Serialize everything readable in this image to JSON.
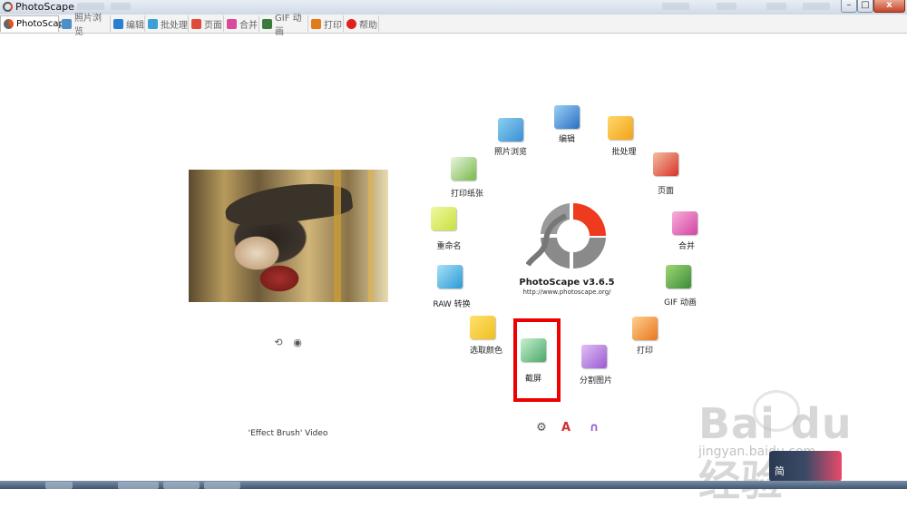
{
  "window": {
    "title": "PhotoScape",
    "buttons": {
      "minimize": "–",
      "maximize": "□",
      "close": "x"
    }
  },
  "tabs": [
    {
      "label": "PhotoScape",
      "icon": "photoscape-icon",
      "color": "#e8521e",
      "active": true
    },
    {
      "label": "照片浏览",
      "icon": "viewer-icon",
      "color": "#4a90c9",
      "active": false
    },
    {
      "label": "编辑",
      "icon": "editor-icon",
      "color": "#2a7fd4",
      "active": false
    },
    {
      "label": "批处理",
      "icon": "batch-icon",
      "color": "#3aa0d8",
      "active": false
    },
    {
      "label": "页面",
      "icon": "page-icon",
      "color": "#e04a3a",
      "active": false
    },
    {
      "label": "合并",
      "icon": "combine-icon",
      "color": "#d84a9a",
      "active": false
    },
    {
      "label": "GIF 动画",
      "icon": "gif-icon",
      "color": "#3a7a3a",
      "active": false
    },
    {
      "label": "打印",
      "icon": "print-icon",
      "color": "#e07a1a",
      "active": false
    },
    {
      "label": "帮助",
      "icon": "help-icon",
      "color": "#e02020",
      "active": false
    }
  ],
  "photo": {
    "caption": "'Effect Brush' Video",
    "prev": "⟲",
    "next": "◉"
  },
  "logo": {
    "name": "PhotoScape v3.6.5",
    "url": "http://www.photoscape.org/",
    "accent": "#ee3b1d",
    "gray": "#8a8a8a"
  },
  "tools": [
    {
      "label": "照片浏览",
      "icon": "viewer-icon",
      "color": "#3b8ed6"
    },
    {
      "label": "编辑",
      "icon": "editor-icon",
      "color": "#2b6fc4"
    },
    {
      "label": "批处理",
      "icon": "batch-icon",
      "color": "#f2a21a"
    },
    {
      "label": "页面",
      "icon": "page-icon",
      "color": "#d8322a"
    },
    {
      "label": "合并",
      "icon": "combine-icon",
      "color": "#d444a4"
    },
    {
      "label": "GIF 动画",
      "icon": "gif-icon",
      "color": "#3c8a3c"
    },
    {
      "label": "打印",
      "icon": "print-icon",
      "color": "#e8761e"
    },
    {
      "label": "分割图片",
      "icon": "splitter-icon",
      "color": "#9a5ad4"
    },
    {
      "label": "截屏",
      "icon": "screen-capture-icon",
      "color": "#4aa86a"
    },
    {
      "label": "选取颜色",
      "icon": "color-picker-icon",
      "color": "#f0c020"
    },
    {
      "label": "RAW 转换",
      "icon": "raw-converter-icon",
      "color": "#2a9ad4"
    },
    {
      "label": "重命名",
      "icon": "rename-icon",
      "color": "#c8e040"
    },
    {
      "label": "打印纸张",
      "icon": "paper-print-icon",
      "color": "#78b848"
    }
  ],
  "bottom_icons": [
    {
      "name": "settings-icon",
      "glyph": "⚙",
      "color": "#555"
    },
    {
      "name": "language-icon",
      "glyph": "A",
      "color": "#d03030"
    },
    {
      "name": "user-icon",
      "glyph": "∩",
      "color": "#9a5ad4"
    }
  ],
  "watermark": {
    "text": "Bai du 经验",
    "sub": "jingyan.baidu.com",
    "lang_badge": "简"
  }
}
